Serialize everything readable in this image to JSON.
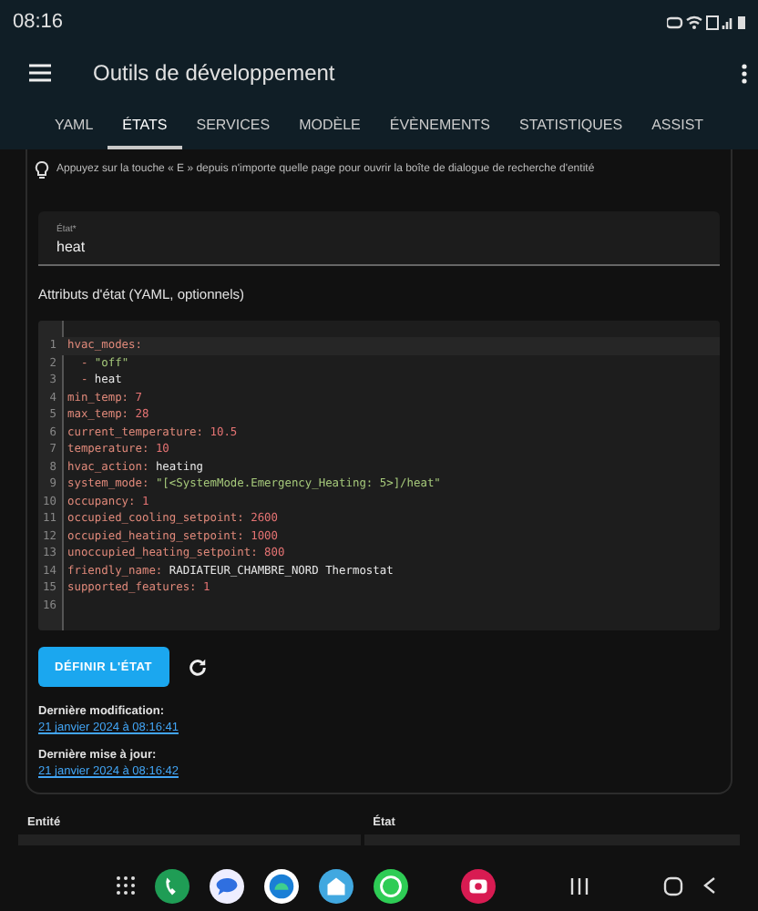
{
  "status_bar": {
    "time": "08:16"
  },
  "app_bar": {
    "title": "Outils de développement"
  },
  "tabs": [
    {
      "label": "YAML",
      "selected": false
    },
    {
      "label": "ÉTATS",
      "selected": true
    },
    {
      "label": "SERVICES",
      "selected": false
    },
    {
      "label": "MODÈLE",
      "selected": false
    },
    {
      "label": "ÉVÈNEMENTS",
      "selected": false
    },
    {
      "label": "STATISTIQUES",
      "selected": false
    },
    {
      "label": "ASSIST",
      "selected": false
    }
  ],
  "tip": "Appuyez sur la touche « E » depuis n'importe quelle page pour ouvrir la boîte de dialogue de recherche d'entité",
  "state_field": {
    "label": "État*",
    "value": "heat"
  },
  "attributes_label": "Attributs d'état (YAML, optionnels)",
  "code_lines": [
    {
      "number": "1",
      "kind": "key",
      "key": "hvac_modes:"
    },
    {
      "number": "2",
      "kind": "item",
      "dash": "-",
      "value": {
        "text": "\"off\"",
        "kind": "string"
      }
    },
    {
      "number": "3",
      "kind": "item",
      "dash": "-",
      "value": {
        "text": "heat",
        "kind": "plain"
      }
    },
    {
      "number": "4",
      "kind": "pair",
      "key": "min_temp:",
      "value": {
        "text": "7",
        "kind": "number"
      }
    },
    {
      "number": "5",
      "kind": "pair",
      "key": "max_temp:",
      "value": {
        "text": "28",
        "kind": "number"
      }
    },
    {
      "number": "6",
      "kind": "pair",
      "key": "current_temperature:",
      "value": {
        "text": "10.5",
        "kind": "number"
      }
    },
    {
      "number": "7",
      "kind": "pair",
      "key": "temperature:",
      "value": {
        "text": "10",
        "kind": "number"
      }
    },
    {
      "number": "8",
      "kind": "pair",
      "key": "hvac_action:",
      "value": {
        "text": "heating",
        "kind": "plain"
      }
    },
    {
      "number": "9",
      "kind": "pair",
      "key": "system_mode:",
      "value": {
        "text": "\"[<SystemMode.Emergency_Heating: 5>]/heat\"",
        "kind": "string"
      }
    },
    {
      "number": "10",
      "kind": "pair",
      "key": "occupancy:",
      "value": {
        "text": "1",
        "kind": "number"
      }
    },
    {
      "number": "11",
      "kind": "pair",
      "key": "occupied_cooling_setpoint:",
      "value": {
        "text": "2600",
        "kind": "number"
      }
    },
    {
      "number": "12",
      "kind": "pair",
      "key": "occupied_heating_setpoint:",
      "value": {
        "text": "1000",
        "kind": "number"
      }
    },
    {
      "number": "13",
      "kind": "pair",
      "key": "unoccupied_heating_setpoint:",
      "value": {
        "text": "800",
        "kind": "number"
      }
    },
    {
      "number": "14",
      "kind": "pair",
      "key": "friendly_name:",
      "value": {
        "text": "RADIATEUR_CHAMBRE_NORD Thermostat",
        "kind": "plain"
      }
    },
    {
      "number": "15",
      "kind": "pair",
      "key": "supported_features:",
      "value": {
        "text": "1",
        "kind": "number"
      }
    },
    {
      "number": "16",
      "kind": "empty"
    }
  ],
  "set_button": "DÉFINIR L'ÉTAT",
  "last_changed": {
    "label": "Dernière modification:",
    "value": "21 janvier 2024 à 08:16:41"
  },
  "last_updated": {
    "label": "Dernière mise à jour:",
    "value": "21 janvier 2024 à 08:16:42"
  },
  "table": {
    "columns": [
      "Entité",
      "État"
    ]
  }
}
